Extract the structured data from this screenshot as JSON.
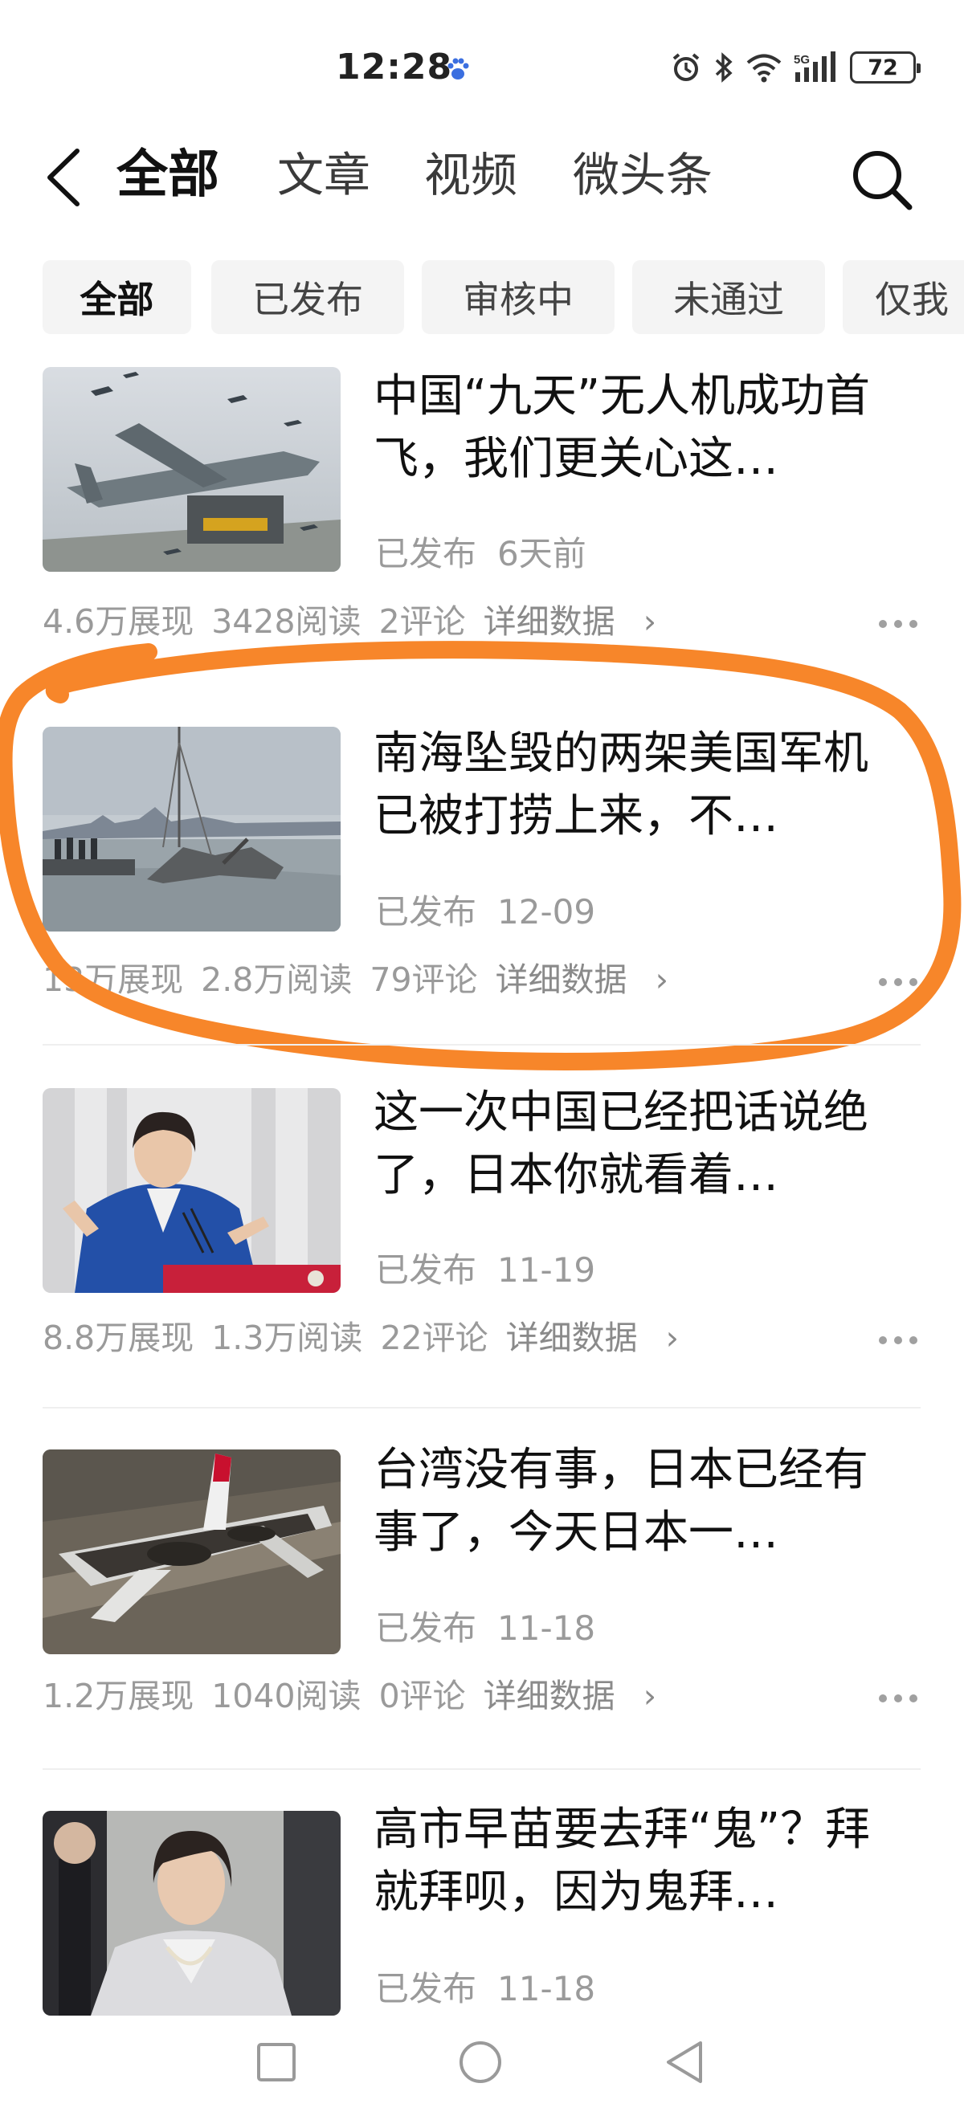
{
  "status_bar": {
    "time": "12:28",
    "network": "5G",
    "battery": "72",
    "icons": [
      "baidu-paw-icon",
      "alarm-icon",
      "bluetooth-icon",
      "wifi-icon",
      "signal-icon",
      "battery-icon"
    ]
  },
  "top_nav": {
    "tabs": [
      {
        "label": "全部",
        "active": true
      },
      {
        "label": "文章",
        "active": false
      },
      {
        "label": "视频",
        "active": false
      },
      {
        "label": "微头条",
        "active": false
      }
    ],
    "icons": [
      "back-arrow-icon",
      "search-icon"
    ]
  },
  "filters": [
    {
      "label": "全部",
      "active": true
    },
    {
      "label": "已发布",
      "active": false
    },
    {
      "label": "审核中",
      "active": false
    },
    {
      "label": "未通过",
      "active": false
    },
    {
      "label": "仅我",
      "active": false
    }
  ],
  "articles": [
    {
      "title": "中国“九天”无人机成功首飞，我们更关心这…",
      "status": "已发布",
      "date": "6天前",
      "impressions": "4.6万展现",
      "reads": "3428阅读",
      "comments": "2评论",
      "detail": "详细数据",
      "thumb": "drone-image"
    },
    {
      "title": "南海坠毁的两架美国军机已被打捞上来，不…",
      "status": "已发布",
      "date": "12-09",
      "impressions": "13万展现",
      "reads": "2.8万阅读",
      "comments": "79评论",
      "detail": "详细数据",
      "thumb": "wreck-recovery-image",
      "highlighted": true,
      "highlight_color": "#f7862a"
    },
    {
      "title": "这一次中国已经把话说绝了，日本你就看着…",
      "status": "已发布",
      "date": "11-19",
      "impressions": "8.8万展现",
      "reads": "1.3万阅读",
      "comments": "22评论",
      "detail": "详细数据",
      "thumb": "speaker-podium-image"
    },
    {
      "title": "台湾没有事，日本已经有事了，今天日本一…",
      "status": "已发布",
      "date": "11-18",
      "impressions": "1.2万展现",
      "reads": "1040阅读",
      "comments": "0评论",
      "detail": "详细数据",
      "thumb": "burned-airliner-image"
    },
    {
      "title": "高市早苗要去拜“鬼”？拜就拜呗，因为鬼拜…",
      "status": "已发布",
      "date": "11-18",
      "thumb": "portrait-image"
    }
  ],
  "system_nav": [
    "recent-apps-icon",
    "home-icon",
    "back-icon"
  ]
}
